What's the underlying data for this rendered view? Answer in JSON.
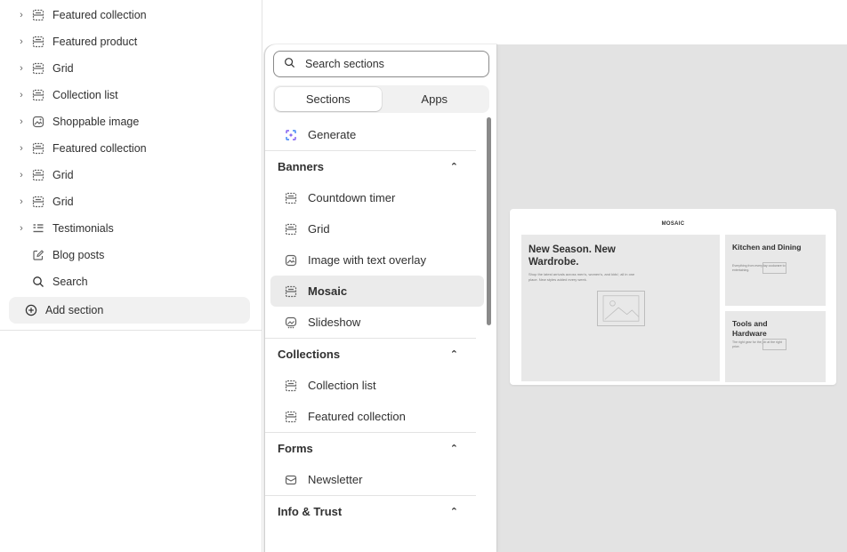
{
  "sidebar": {
    "items": [
      {
        "label": "Featured collection",
        "icon": "section-icon",
        "expandable": true
      },
      {
        "label": "Featured product",
        "icon": "section-icon",
        "expandable": true
      },
      {
        "label": "Grid",
        "icon": "section-icon",
        "expandable": true
      },
      {
        "label": "Collection list",
        "icon": "section-icon",
        "expandable": true
      },
      {
        "label": "Shoppable image",
        "icon": "image-icon",
        "expandable": true
      },
      {
        "label": "Featured collection",
        "icon": "section-icon",
        "expandable": true
      },
      {
        "label": "Grid",
        "icon": "section-icon",
        "expandable": true
      },
      {
        "label": "Grid",
        "icon": "section-icon",
        "expandable": true
      },
      {
        "label": "Testimonials",
        "icon": "testimonials-icon",
        "expandable": true
      },
      {
        "label": "Blog posts",
        "icon": "edit-icon",
        "expandable": false
      },
      {
        "label": "Search",
        "icon": "search-icon",
        "expandable": false
      }
    ],
    "add_section_label": "Add section"
  },
  "picker": {
    "search_placeholder": "Search sections",
    "tabs": {
      "sections": "Sections",
      "apps": "Apps"
    },
    "generate_label": "Generate",
    "groups": [
      {
        "title": "Banners",
        "items": [
          "Countdown timer",
          "Grid",
          "Image with text overlay",
          "Mosaic",
          "Slideshow"
        ]
      },
      {
        "title": "Collections",
        "items": [
          "Collection list",
          "Featured collection"
        ]
      },
      {
        "title": "Forms",
        "items": [
          "Newsletter"
        ]
      },
      {
        "title": "Info & Trust",
        "items": []
      }
    ],
    "selected_item": "Mosaic"
  },
  "preview": {
    "title": "MOSAIC",
    "main_heading": "New Season. New Wardrobe.",
    "main_text": "Shop the latest arrivals across men's, women's, and kids'; all in one place. New styles added every week.",
    "tile1_heading": "Kitchen and Dining",
    "tile1_text": "Everything from everyday cookware to entertaining.",
    "tile2_heading": "Tools and Hardware",
    "tile2_text": "The right gear for the job at the right price."
  },
  "colors": {
    "accent": "#303030",
    "canvas": "#e3e3e3",
    "selected": "#ebebeb",
    "generate_icon": "#7e5bef"
  }
}
